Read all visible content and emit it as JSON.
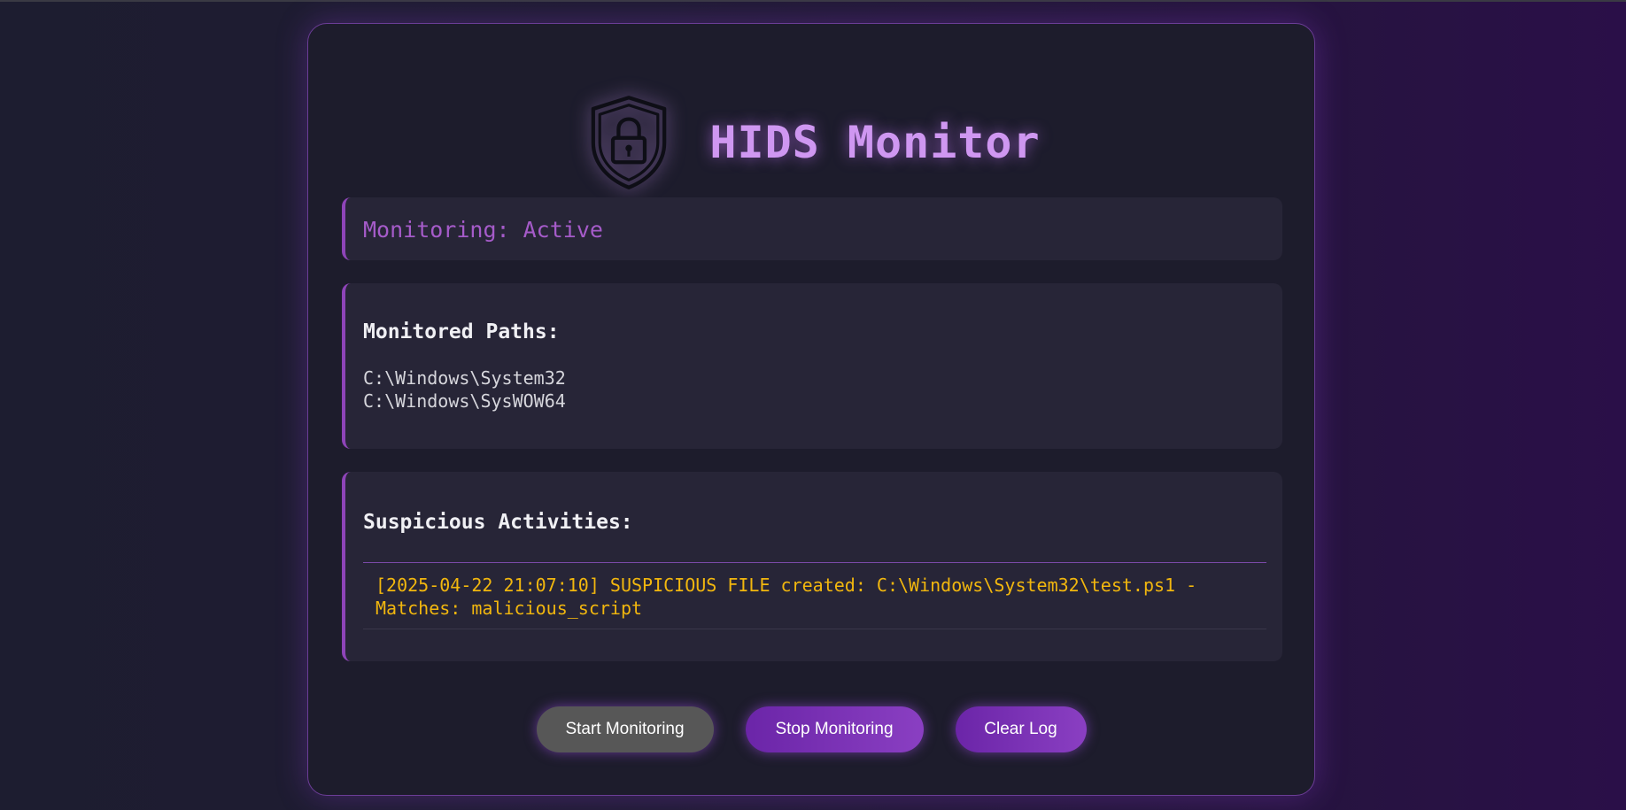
{
  "app": {
    "title": "HIDS Monitor",
    "logo_icon": "shield-lock-icon"
  },
  "status": {
    "text": "Monitoring: Active"
  },
  "monitored_paths": {
    "heading": "Monitored Paths:",
    "items": [
      "C:\\Windows\\System32",
      "C:\\Windows\\SysWOW64"
    ]
  },
  "suspicious_activities": {
    "heading": "Suspicious Activities:",
    "entries": [
      "[2025-04-22 21:07:10] SUSPICIOUS FILE created: C:\\Windows\\System32\\test.ps1 - Matches: malicious_script"
    ]
  },
  "buttons": {
    "start_label": "Start Monitoring",
    "stop_label": "Stop Monitoring",
    "clear_label": "Clear Log"
  },
  "colors": {
    "accent": "#8e44b8",
    "title": "#cf97f1",
    "status": "#a55bc9",
    "warning": "#f2b70e",
    "start_button": "#575757",
    "action_button": "#7a32b5"
  }
}
